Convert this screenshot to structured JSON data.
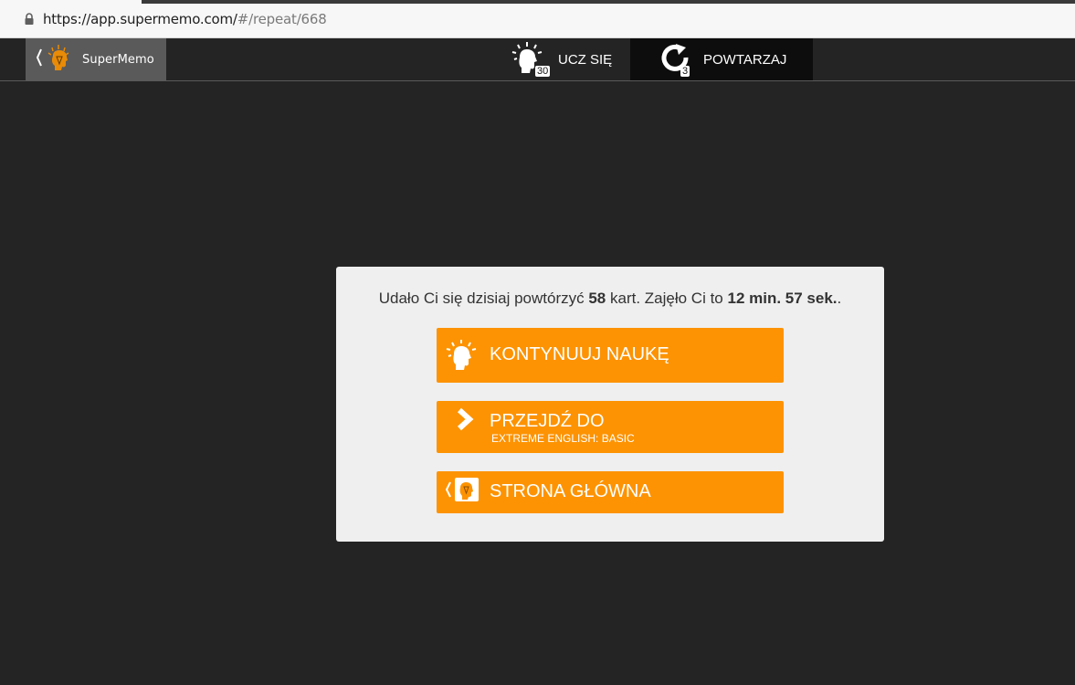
{
  "browser": {
    "url_host": "https://app.supermemo.com/",
    "url_path": "#/repeat/668",
    "lock_icon": "lock-icon"
  },
  "header": {
    "logo_text": "SuperMemo",
    "nav": {
      "learn": {
        "label": "UCZ SIĘ",
        "badge": "30",
        "icon": "lightbulb-head-icon"
      },
      "repeat": {
        "label": "POWTARZAJ",
        "badge": "3",
        "icon": "repeat-icon"
      }
    }
  },
  "summary": {
    "prefix": "Udało Ci się dzisiaj powtórzyć ",
    "cards_count": "58",
    "middle": " kart. Zajęło Ci to ",
    "duration": "12 min. 57 sek.",
    "suffix": "."
  },
  "actions": {
    "continue": {
      "label": "KONTYNUUJ NAUKĘ",
      "icon": "lightbulb-head-icon"
    },
    "goto": {
      "label": "PRZEJDŹ DO",
      "sublabel": "EXTREME ENGLISH: BASIC",
      "icon": "chevron-right-icon"
    },
    "home": {
      "label": "STRONA GŁÓWNA",
      "icon": "supermemo-logo-icon"
    }
  },
  "colors": {
    "accent": "#fd9302",
    "background": "#242424",
    "card": "#efefef",
    "active_nav": "#0d0d0d"
  }
}
